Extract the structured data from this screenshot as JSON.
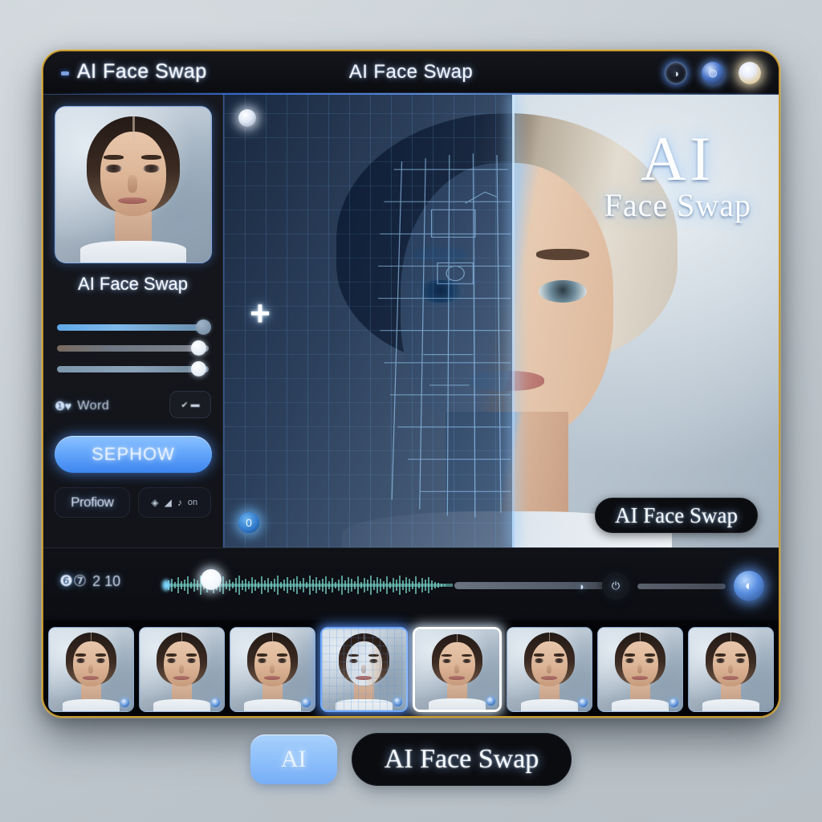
{
  "window": {
    "app_name": "AI Face Swap",
    "title": "AI Face Swap",
    "accent_color": "#62a5fb",
    "border_color": "#c99a2e",
    "controls": [
      {
        "name": "minimize",
        "glyph": "◑"
      },
      {
        "name": "maximize",
        "glyph": "◍"
      },
      {
        "name": "close",
        "glyph": ""
      }
    ]
  },
  "sidebar": {
    "source_label": "AI Face Swap",
    "sliders": [
      {
        "name": "blend",
        "value": 100
      },
      {
        "name": "strength",
        "value": 92
      },
      {
        "name": "smoothing",
        "value": 92
      }
    ],
    "meta": {
      "icon": "❶♥",
      "text": "Word",
      "chip_glyphs": [
        "✔",
        "▬"
      ]
    },
    "primary_action": "SEPHOW",
    "preview_chip": "Profiow",
    "tool_chip": {
      "glyphs": [
        "◈",
        "◢",
        "♪"
      ],
      "label": "on"
    }
  },
  "canvas": {
    "badge_top_left": "",
    "plus_icon": "+",
    "badge_bottom_left": "0",
    "watermark_title": "AI",
    "watermark_sub": "Face Swap",
    "pill_label": "AI Face Swap"
  },
  "timeline": {
    "icon": "❻⑦",
    "time": "2 10",
    "buttons": [
      {
        "name": "moon",
        "glyph": "◗"
      },
      {
        "name": "power",
        "glyph": "⏻"
      },
      {
        "name": "mic",
        "glyph": "◐"
      }
    ]
  },
  "filmstrip": {
    "frames": [
      {
        "index": 1,
        "state": "normal",
        "badge": true
      },
      {
        "index": 2,
        "state": "normal",
        "badge": true
      },
      {
        "index": 3,
        "state": "normal",
        "badge": true
      },
      {
        "index": 4,
        "state": "active",
        "badge": true
      },
      {
        "index": 5,
        "state": "selected",
        "badge": true
      },
      {
        "index": 6,
        "state": "normal",
        "badge": true
      },
      {
        "index": 7,
        "state": "normal",
        "badge": true
      },
      {
        "index": 8,
        "state": "normal",
        "badge": false
      }
    ]
  },
  "footer": {
    "ai_button": "AI",
    "title_pill": "AI Face Swap"
  }
}
